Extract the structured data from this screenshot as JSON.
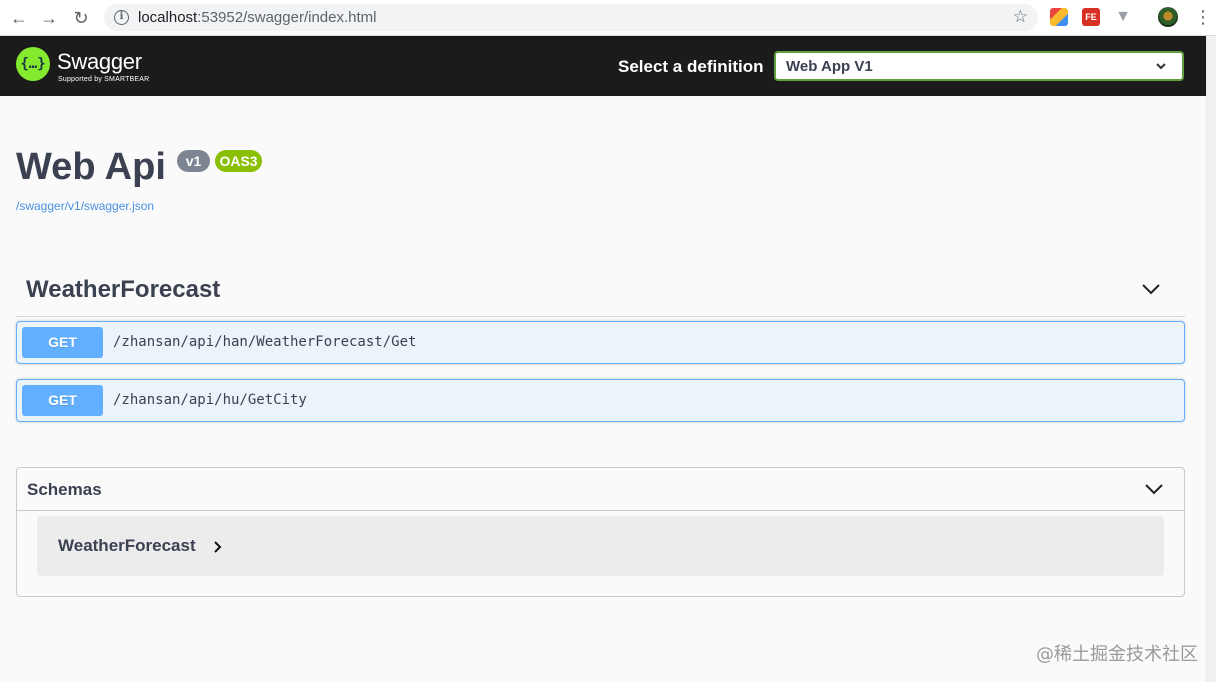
{
  "browser": {
    "back_icon": "←",
    "forward_icon": "→",
    "reload_icon": "↻",
    "url_host": "localhost",
    "url_path": ":53952/swagger/index.html",
    "star_icon": "☆",
    "ext_fe_label": "FE",
    "ext_v_label": "▼",
    "menu_icon": "⋮"
  },
  "topbar": {
    "logo_symbol": "{…}",
    "logo_text": "Swagger",
    "logo_subtext": "Supported by SMARTBEAR",
    "definition_label": "Select a definition",
    "definition_selected": "Web App V1",
    "accent_color": "#62a03f"
  },
  "info": {
    "title": "Web Api",
    "version_badge": "v1",
    "oas_badge": "OAS3",
    "spec_link": "/swagger/v1/swagger.json"
  },
  "tag": {
    "name": "WeatherForecast",
    "operations": [
      {
        "method": "GET",
        "path": "/zhansan/api/han/WeatherForecast/Get"
      },
      {
        "method": "GET",
        "path": "/zhansan/api/hu/GetCity"
      }
    ]
  },
  "schemas": {
    "title": "Schemas",
    "models": [
      {
        "name": "WeatherForecast"
      }
    ]
  },
  "watermark": "@稀土掘金技术社区",
  "colors": {
    "get_color": "#61affe",
    "oas_badge_color": "#89bf04",
    "version_badge_color": "#7d8492"
  }
}
